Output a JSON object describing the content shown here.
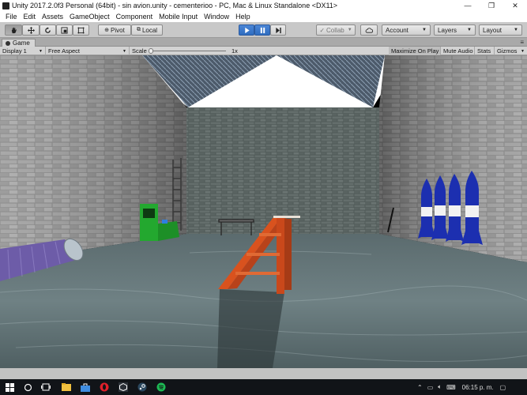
{
  "window": {
    "title": "Unity 2017.2.0f3 Personal (64bit) - sin avion.unity - cementerioo - PC, Mac & Linux Standalone <DX11>",
    "controls": {
      "minimize": "—",
      "maximize": "❐",
      "close": "✕"
    }
  },
  "menubar": {
    "items": [
      "File",
      "Edit",
      "Assets",
      "GameObject",
      "Component",
      "Mobile Input",
      "Window",
      "Help"
    ]
  },
  "toolbar": {
    "tools": [
      "hand-tool",
      "move-tool",
      "rotate-tool",
      "scale-tool",
      "rect-tool"
    ],
    "pivot_label": "Pivot",
    "local_label": "Local",
    "collab_label": "Collab",
    "account_label": "Account",
    "layers_label": "Layers",
    "layout_label": "Layout"
  },
  "game_tab": {
    "label": "Game"
  },
  "game_controls": {
    "display": "Display 1",
    "aspect": "Free Aspect",
    "scale_label": "Scale",
    "scale_value": "1x",
    "maximize_on_play": "Maximize On Play",
    "mute_audio": "Mute Audio",
    "stats": "Stats",
    "gizmos": "Gizmos"
  },
  "taskbar": {
    "clock": "06:15 p. m.",
    "apps": [
      "start-icon",
      "search-icon",
      "task-view-icon",
      "file-explorer-icon",
      "store-icon",
      "opera-icon",
      "folder-icon",
      "unity-icon",
      "steam-icon",
      "spotify-icon"
    ]
  },
  "colors": {
    "play_active": "#3a7bd5",
    "toolbar_bg": "#c8c8c8",
    "taskbar_bg": "#111418",
    "stair_orange": "#d9521e",
    "missile_blue": "#1c2fb0"
  }
}
